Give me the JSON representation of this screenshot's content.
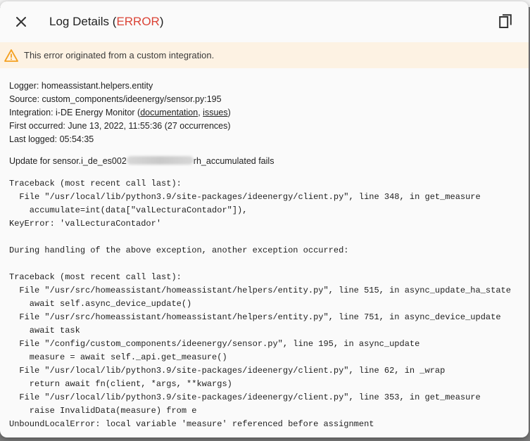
{
  "dialog": {
    "title_prefix": "Log Details (",
    "title_level": "ERROR",
    "title_suffix": ")",
    "warning": "This error originated from a custom integration."
  },
  "details": {
    "logger": "Logger: homeassistant.helpers.entity",
    "source": "Source: custom_components/ideenergy/sensor.py:195",
    "integration_prefix": "Integration: i-DE Energy Monitor (",
    "documentation_link": "documentation",
    "separator": ", ",
    "issues_link": "issues",
    "integration_suffix": ")",
    "first_occurred": "First occurred: June 13, 2022, 11:55:36 (27 occurrences)",
    "last_logged": "Last logged: 05:54:35"
  },
  "message": {
    "prefix": "Update for sensor.i_de_es002",
    "suffix": "rh_accumulated fails"
  },
  "traceback": "Traceback (most recent call last):\n  File \"/usr/local/lib/python3.9/site-packages/ideenergy/client.py\", line 348, in get_measure\n    accumulate=int(data[\"valLecturaContador\"]),\nKeyError: 'valLecturaContador'\n\nDuring handling of the above exception, another exception occurred:\n\nTraceback (most recent call last):\n  File \"/usr/src/homeassistant/homeassistant/helpers/entity.py\", line 515, in async_update_ha_state\n    await self.async_device_update()\n  File \"/usr/src/homeassistant/homeassistant/helpers/entity.py\", line 751, in async_device_update\n    await task\n  File \"/config/custom_components/ideenergy/sensor.py\", line 195, in async_update\n    measure = await self._api.get_measure()\n  File \"/usr/local/lib/python3.9/site-packages/ideenergy/client.py\", line 62, in _wrap\n    return await fn(client, *args, **kwargs)\n  File \"/usr/local/lib/python3.9/site-packages/ideenergy/client.py\", line 353, in get_measure\n    raise InvalidData(measure) from e\nUnboundLocalError: local variable 'measure' referenced before assignment",
  "icons": {
    "close": "close-icon",
    "copy": "copy-icon",
    "warning": "warning-icon"
  },
  "colors": {
    "error": "#db4437",
    "warning_bg": "#fdf2e3",
    "warning_icon": "#f4a020"
  }
}
